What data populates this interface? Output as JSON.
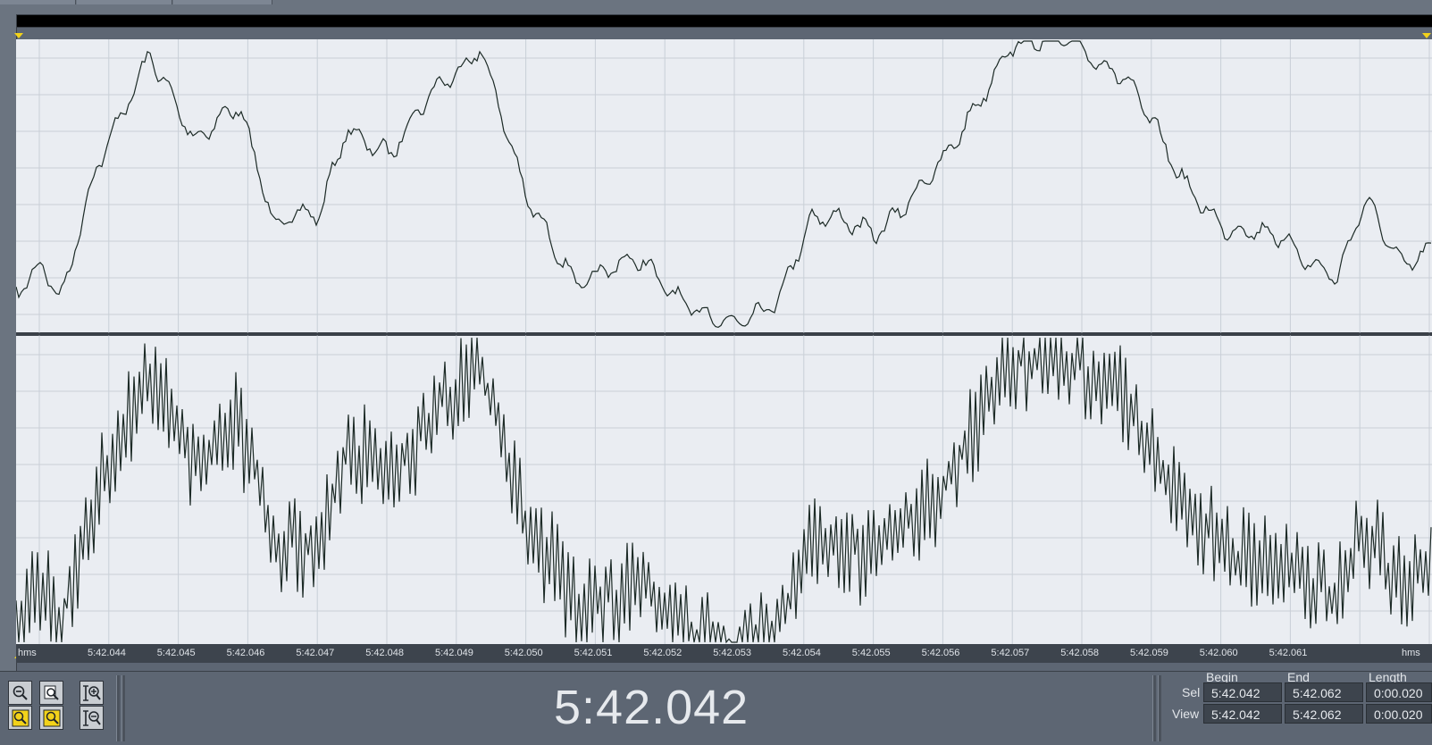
{
  "ruler": {
    "unit_left": "hms",
    "unit_right": "hms",
    "ticks": [
      "5:42.044",
      "5:42.045",
      "5:42.046",
      "5:42.047",
      "5:42.048",
      "5:42.049",
      "5:42.050",
      "5:42.051",
      "5:42.052",
      "5:42.053",
      "5:42.054",
      "5:42.055",
      "5:42.056",
      "5:42.057",
      "5:42.058",
      "5:42.059",
      "5:42.060",
      "5:42.061"
    ]
  },
  "time_display": {
    "current": "5:42.042"
  },
  "selection": {
    "headers": {
      "begin": "Begin",
      "end": "End",
      "length": "Length"
    },
    "rows": [
      {
        "label": "Sel",
        "begin": "5:42.042",
        "end": "5:42.062",
        "length": "0:00.020"
      },
      {
        "label": "View",
        "begin": "5:42.042",
        "end": "5:42.062",
        "length": "0:00.020"
      }
    ]
  },
  "zoom_toolbar": [
    {
      "name": "zoom-out-icon"
    },
    {
      "name": "zoom-full-icon"
    },
    {
      "name": "zoom-in-vertical-icon"
    },
    {
      "name": "zoom-selection-left-icon"
    },
    {
      "name": "zoom-selection-right-icon"
    },
    {
      "name": "zoom-out-vertical-icon"
    }
  ],
  "colors": {
    "wave_bg": "#eaedf2",
    "wave_line": "#1c2a26",
    "grid": "#c9cfd7",
    "accent_marker": "#f2d21a"
  }
}
